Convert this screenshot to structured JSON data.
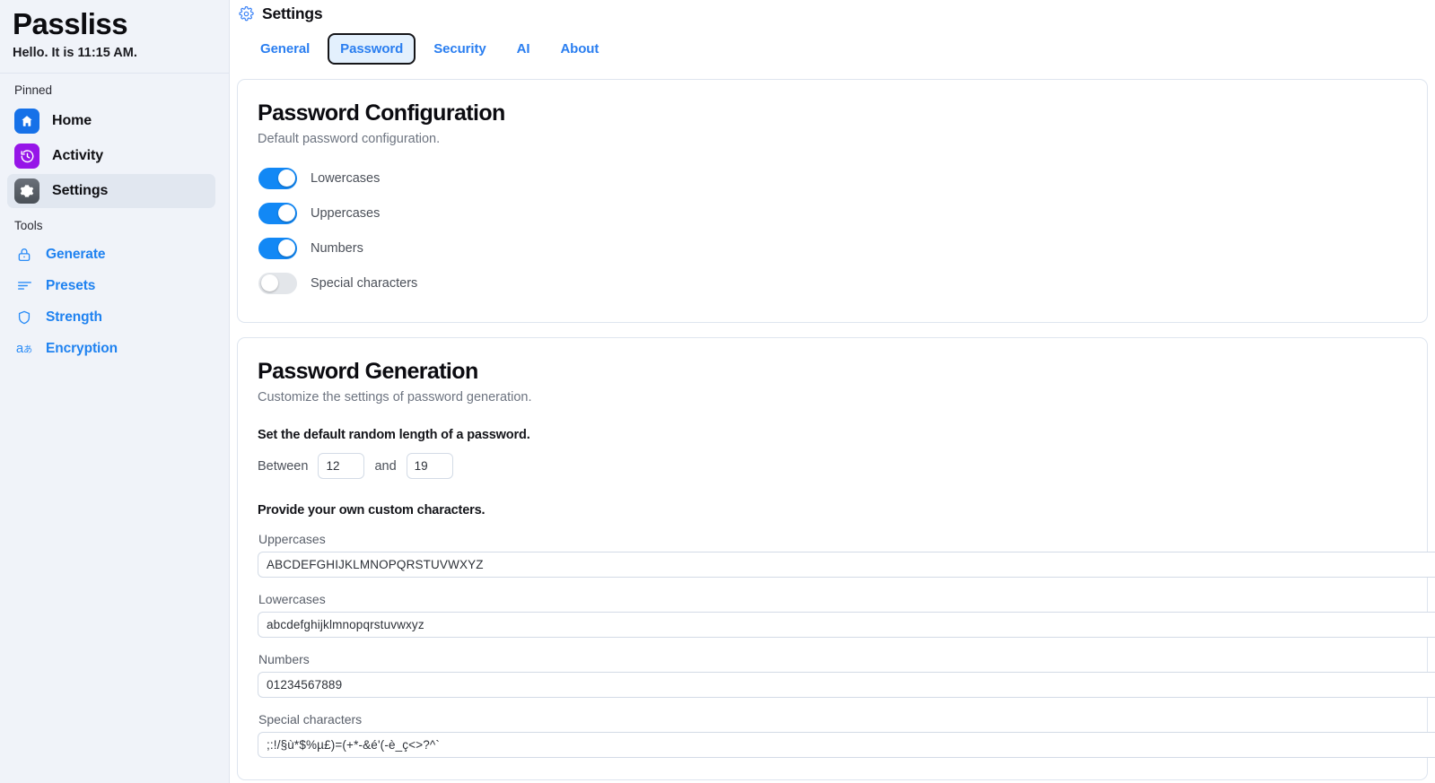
{
  "sidebar": {
    "app_title": "Passliss",
    "greeting": "Hello. It is 11:15 AM.",
    "pinned_label": "Pinned",
    "tools_label": "Tools",
    "pinned": [
      {
        "label": "Home",
        "icon": "home-icon",
        "color": "#1671e8",
        "selected": false
      },
      {
        "label": "Activity",
        "icon": "history-icon",
        "color": "#9615e8",
        "selected": false
      },
      {
        "label": "Settings",
        "icon": "gear-icon",
        "color": "#565c63",
        "selected": true
      }
    ],
    "tools": [
      {
        "label": "Generate",
        "icon": "padlock-icon"
      },
      {
        "label": "Presets",
        "icon": "list-lines-icon"
      },
      {
        "label": "Strength",
        "icon": "shield-icon"
      },
      {
        "label": "Encryption",
        "icon": "translate-icon"
      }
    ]
  },
  "header": {
    "title": "Settings",
    "icon": "gear-icon"
  },
  "tabs": [
    {
      "label": "General",
      "active": false
    },
    {
      "label": "Password",
      "active": true
    },
    {
      "label": "Security",
      "active": false
    },
    {
      "label": "AI",
      "active": false
    },
    {
      "label": "About",
      "active": false
    }
  ],
  "password_configuration": {
    "title": "Password Configuration",
    "subtitle": "Default password configuration.",
    "toggles": [
      {
        "label": "Lowercases",
        "on": true
      },
      {
        "label": "Uppercases",
        "on": true
      },
      {
        "label": "Numbers",
        "on": true
      },
      {
        "label": "Special characters",
        "on": false
      }
    ]
  },
  "password_generation": {
    "title": "Password Generation",
    "subtitle": "Customize the settings of password generation.",
    "length_heading": "Set the default random length of a password.",
    "between_label": "Between",
    "and_label": "and",
    "min_length": "12",
    "max_length": "19",
    "custom_heading": "Provide your own custom characters.",
    "fields": [
      {
        "label": "Uppercases",
        "value": "ABCDEFGHIJKLMNOPQRSTUVWXYZ"
      },
      {
        "label": "Lowercases",
        "value": "abcdefghijklmnopqrstuvwxyz"
      },
      {
        "label": "Numbers",
        "value": "01234567889"
      },
      {
        "label": "Special characters",
        "value": ";:!/§ù*$%µ£)=(+*-&é'(-è_ç<>?^`"
      }
    ]
  },
  "colors": {
    "accent_blue": "#1f82f0",
    "toggle_on": "#1288f5",
    "toggle_off": "#e3e6ea",
    "sidebar_bg": "#f0f3f9",
    "tab_active_bg": "#e3f0fd"
  }
}
